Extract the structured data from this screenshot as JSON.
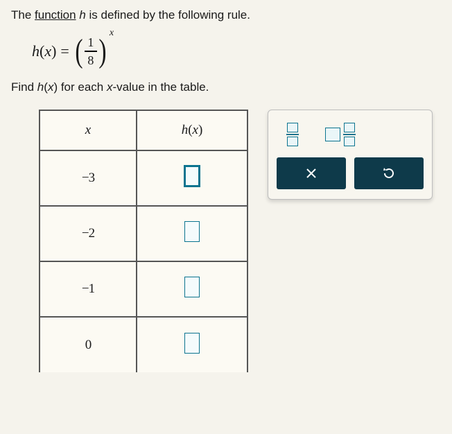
{
  "intro": {
    "prefix": "The ",
    "link": "function",
    "mid": " ",
    "var": "h",
    "suffix": " is defined by the following rule."
  },
  "formula": {
    "lhs_var": "h",
    "lhs_arg_open": "(",
    "lhs_arg": "x",
    "lhs_arg_close": ")",
    "equals": "=",
    "frac_num": "1",
    "frac_den": "8",
    "exponent": "x"
  },
  "instruction": {
    "prefix": "Find ",
    "fn": "h",
    "paren_open": "(",
    "arg": "x",
    "paren_close": ")",
    "mid": " for each ",
    "xvar": "x",
    "suffix": "-value in the table."
  },
  "table": {
    "headers": {
      "col1": "x",
      "col2_fn": "h",
      "col2_open": "(",
      "col2_arg": "x",
      "col2_close": ")"
    },
    "rows": [
      {
        "x": "−3",
        "active": true
      },
      {
        "x": "−2",
        "active": false
      },
      {
        "x": "−1",
        "active": false
      },
      {
        "x": "0",
        "active": false
      }
    ]
  },
  "tools": {
    "fraction_label": "fraction",
    "mixed_fraction_label": "mixed-fraction",
    "clear_label": "clear",
    "reset_label": "reset"
  }
}
